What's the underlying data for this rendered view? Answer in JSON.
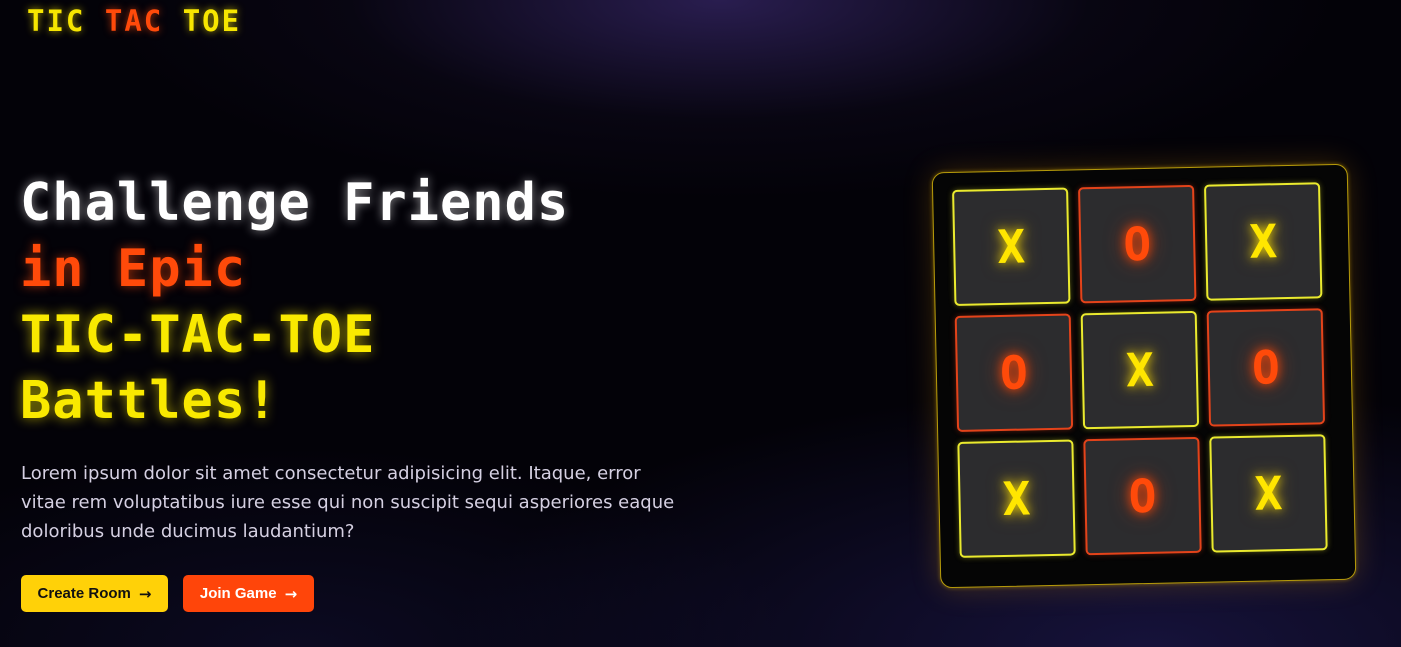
{
  "logo": {
    "part1": "TIC",
    "part2": "TAC",
    "part3": "TOE"
  },
  "hero": {
    "line1": "Challenge Friends",
    "line2": "in Epic",
    "line3": "TIC-TAC-TOE",
    "line4": "Battles!",
    "description": "Lorem ipsum dolor sit amet consectetur adipisicing elit. Itaque, error vitae rem voluptatibus iure esse qui non suscipit sequi asperiores eaque doloribus unde ducimus laudantium?"
  },
  "buttons": {
    "create_room": "Create Room",
    "join_game": "Join Game",
    "arrow_icon": "→"
  },
  "board": {
    "cells": [
      "X",
      "O",
      "X",
      "O",
      "X",
      "O",
      "X",
      "O",
      "X"
    ]
  },
  "colors": {
    "yellow": "#f9e900",
    "orange": "#ff4a0a",
    "white": "#ffffff",
    "create_button_bg": "#ffd108",
    "join_button_bg": "#ff450a"
  }
}
